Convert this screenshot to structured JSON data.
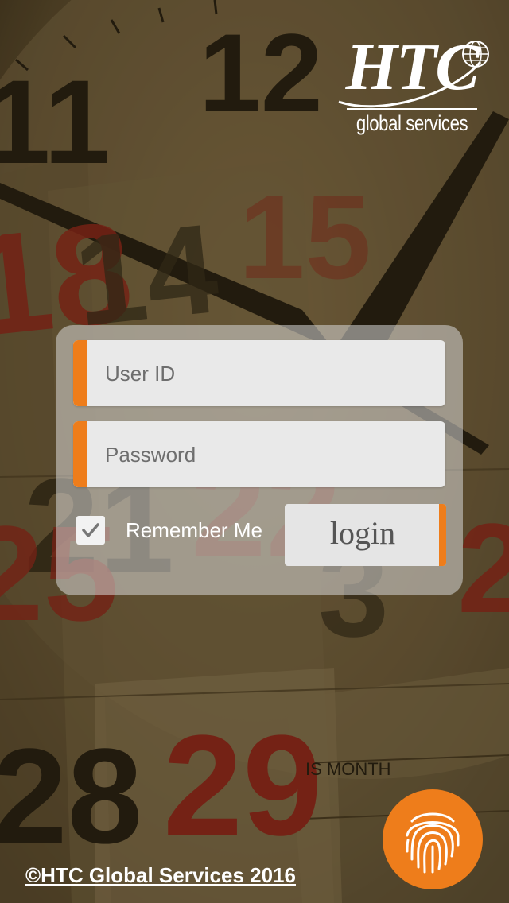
{
  "logo": {
    "brand": "HTC",
    "tagline": "global services"
  },
  "login": {
    "user_id_placeholder": "User ID",
    "password_placeholder": "Password",
    "remember_label": "Remember Me",
    "remember_checked": true,
    "login_label": "login"
  },
  "footer": {
    "copyright": "©HTC Global Services 2016"
  },
  "background": {
    "clock_numbers": [
      "11",
      "12"
    ],
    "calendar_numbers": [
      "18",
      "14",
      "15",
      "21",
      "22",
      "25",
      "28",
      "29",
      "2",
      "3"
    ],
    "calendar_text": "IS MONTH"
  },
  "colors": {
    "accent": "#ee7d1b",
    "panel": "#d7d7d7",
    "field": "#e9e9e9"
  },
  "icons": {
    "fingerprint": "fingerprint-icon",
    "checkbox": "checkmark-icon",
    "logo_globe": "globe-icon"
  }
}
